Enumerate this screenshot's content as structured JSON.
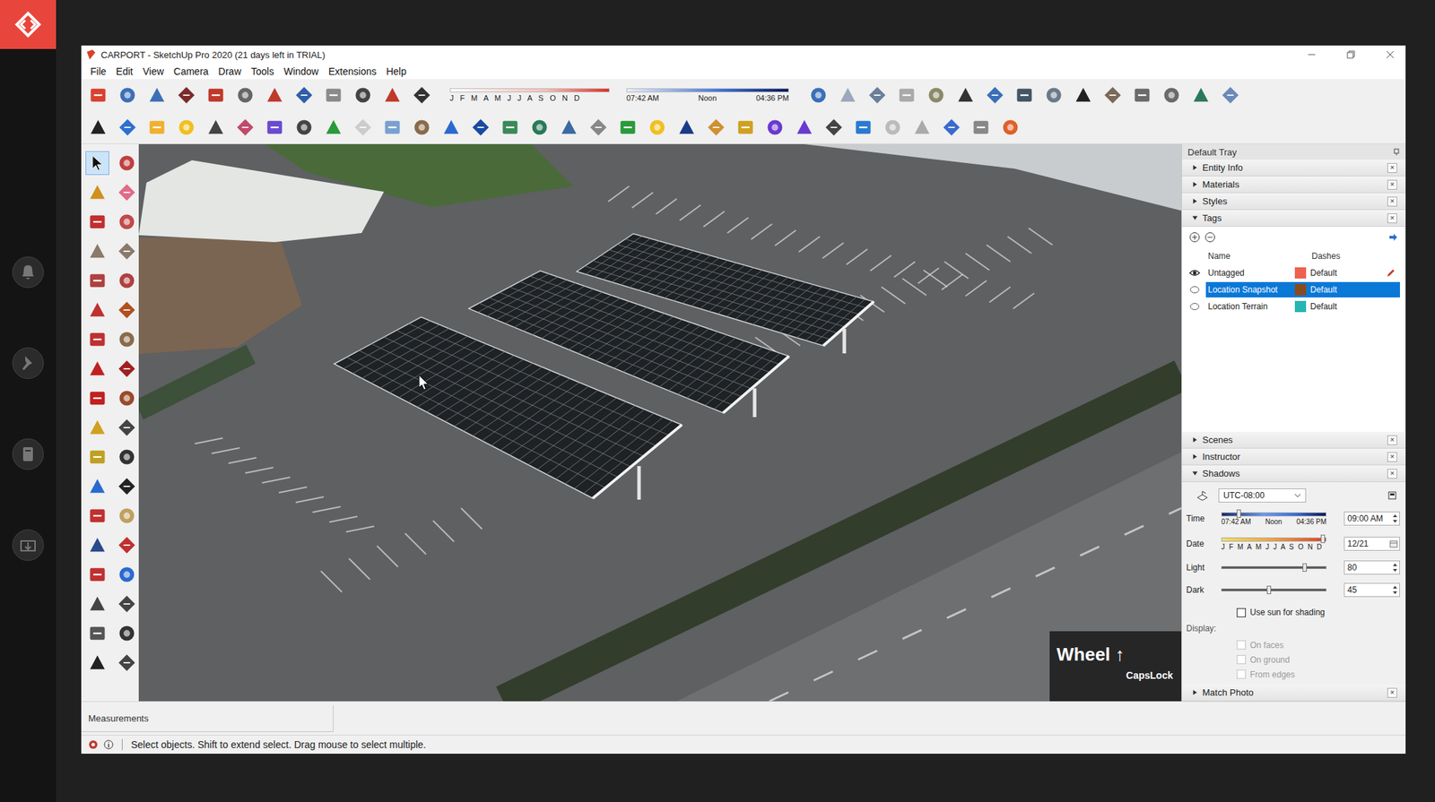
{
  "window": {
    "title": "CARPORT - SketchUp Pro 2020 (21 days left in TRIAL)"
  },
  "menu": [
    "File",
    "Edit",
    "View",
    "Camera",
    "Draw",
    "Tools",
    "Window",
    "Extensions",
    "Help"
  ],
  "toolbar_sliders": {
    "months": "J F M A M J J A S O N D",
    "time_start": "07:42 AM",
    "time_noon": "Noon",
    "time_end": "04:36 PM"
  },
  "tool_palette": [
    {
      "selected": true
    },
    {
      "selected": false
    },
    {
      "selected": false
    },
    {
      "selected": false
    },
    {
      "selected": false
    },
    {
      "selected": false
    },
    {
      "selected": false
    },
    {
      "selected": false
    },
    {
      "selected": false
    },
    {
      "selected": false
    },
    {
      "selected": false
    },
    {
      "selected": false
    },
    {
      "selected": false
    },
    {
      "selected": false
    },
    {
      "selected": false
    },
    {
      "selected": false
    },
    {
      "selected": false
    },
    {
      "selected": false
    },
    {
      "selected": false
    },
    {
      "selected": false
    },
    {
      "selected": false
    },
    {
      "selected": false
    },
    {
      "selected": false
    },
    {
      "selected": false
    },
    {
      "selected": false
    },
    {
      "selected": false
    },
    {
      "selected": false
    },
    {
      "selected": false
    },
    {
      "selected": false
    },
    {
      "selected": false
    },
    {
      "selected": false
    },
    {
      "selected": false
    },
    {
      "selected": false
    },
    {
      "selected": false
    },
    {
      "selected": false
    },
    {
      "selected": false
    }
  ],
  "viewport": {
    "overlay_key": "Wheel ↑",
    "overlay_sub": "CapsLock"
  },
  "tray": {
    "title": "Default Tray",
    "close": "×",
    "sections_top": [
      {
        "label": "Entity Info",
        "expanded": false
      },
      {
        "label": "Materials",
        "expanded": false
      },
      {
        "label": "Styles",
        "expanded": false
      },
      {
        "label": "Tags",
        "expanded": true
      }
    ],
    "tags": {
      "columns": [
        "Name",
        "Dashes"
      ],
      "rows": [
        {
          "name": "Untagged",
          "visible": true,
          "color": "#f0604e",
          "dashes": "Default",
          "selected": false,
          "active": true
        },
        {
          "name": "Location Snapshot",
          "visible": false,
          "color": "#8a4a1c",
          "dashes": "Default",
          "selected": true,
          "active": false
        },
        {
          "name": "Location Terrain",
          "visible": false,
          "color": "#26b5b0",
          "dashes": "Default",
          "selected": false,
          "active": false
        }
      ]
    },
    "sections_mid": [
      {
        "label": "Scenes",
        "expanded": false
      },
      {
        "label": "Instructor",
        "expanded": false
      },
      {
        "label": "Shadows",
        "expanded": true
      }
    ],
    "shadows": {
      "timezone": "UTC-08:00",
      "time": {
        "label": "Time",
        "start": "07:42 AM",
        "noon": "Noon",
        "end": "04:36 PM",
        "value": "09:00 AM",
        "level": 0.16
      },
      "date": {
        "label": "Date",
        "months": "J F M A M J J A S O N D",
        "value": "12/21",
        "level": 0.97
      },
      "light": {
        "label": "Light",
        "value": "80",
        "level": 0.8
      },
      "dark": {
        "label": "Dark",
        "value": "45",
        "level": 0.45
      },
      "use_sun": {
        "label": "Use sun for shading",
        "checked": false
      },
      "display_label": "Display:",
      "display": [
        {
          "label": "On faces",
          "checked": false,
          "disabled": true
        },
        {
          "label": "On ground",
          "checked": false,
          "disabled": true
        },
        {
          "label": "From edges",
          "checked": false,
          "disabled": true
        }
      ]
    },
    "match_photo": {
      "label": "Match Photo",
      "expanded": false
    }
  },
  "measurements": {
    "label": "Measurements",
    "value": ""
  },
  "status_bar": "Select objects. Shift to extend select. Drag mouse to select multiple."
}
